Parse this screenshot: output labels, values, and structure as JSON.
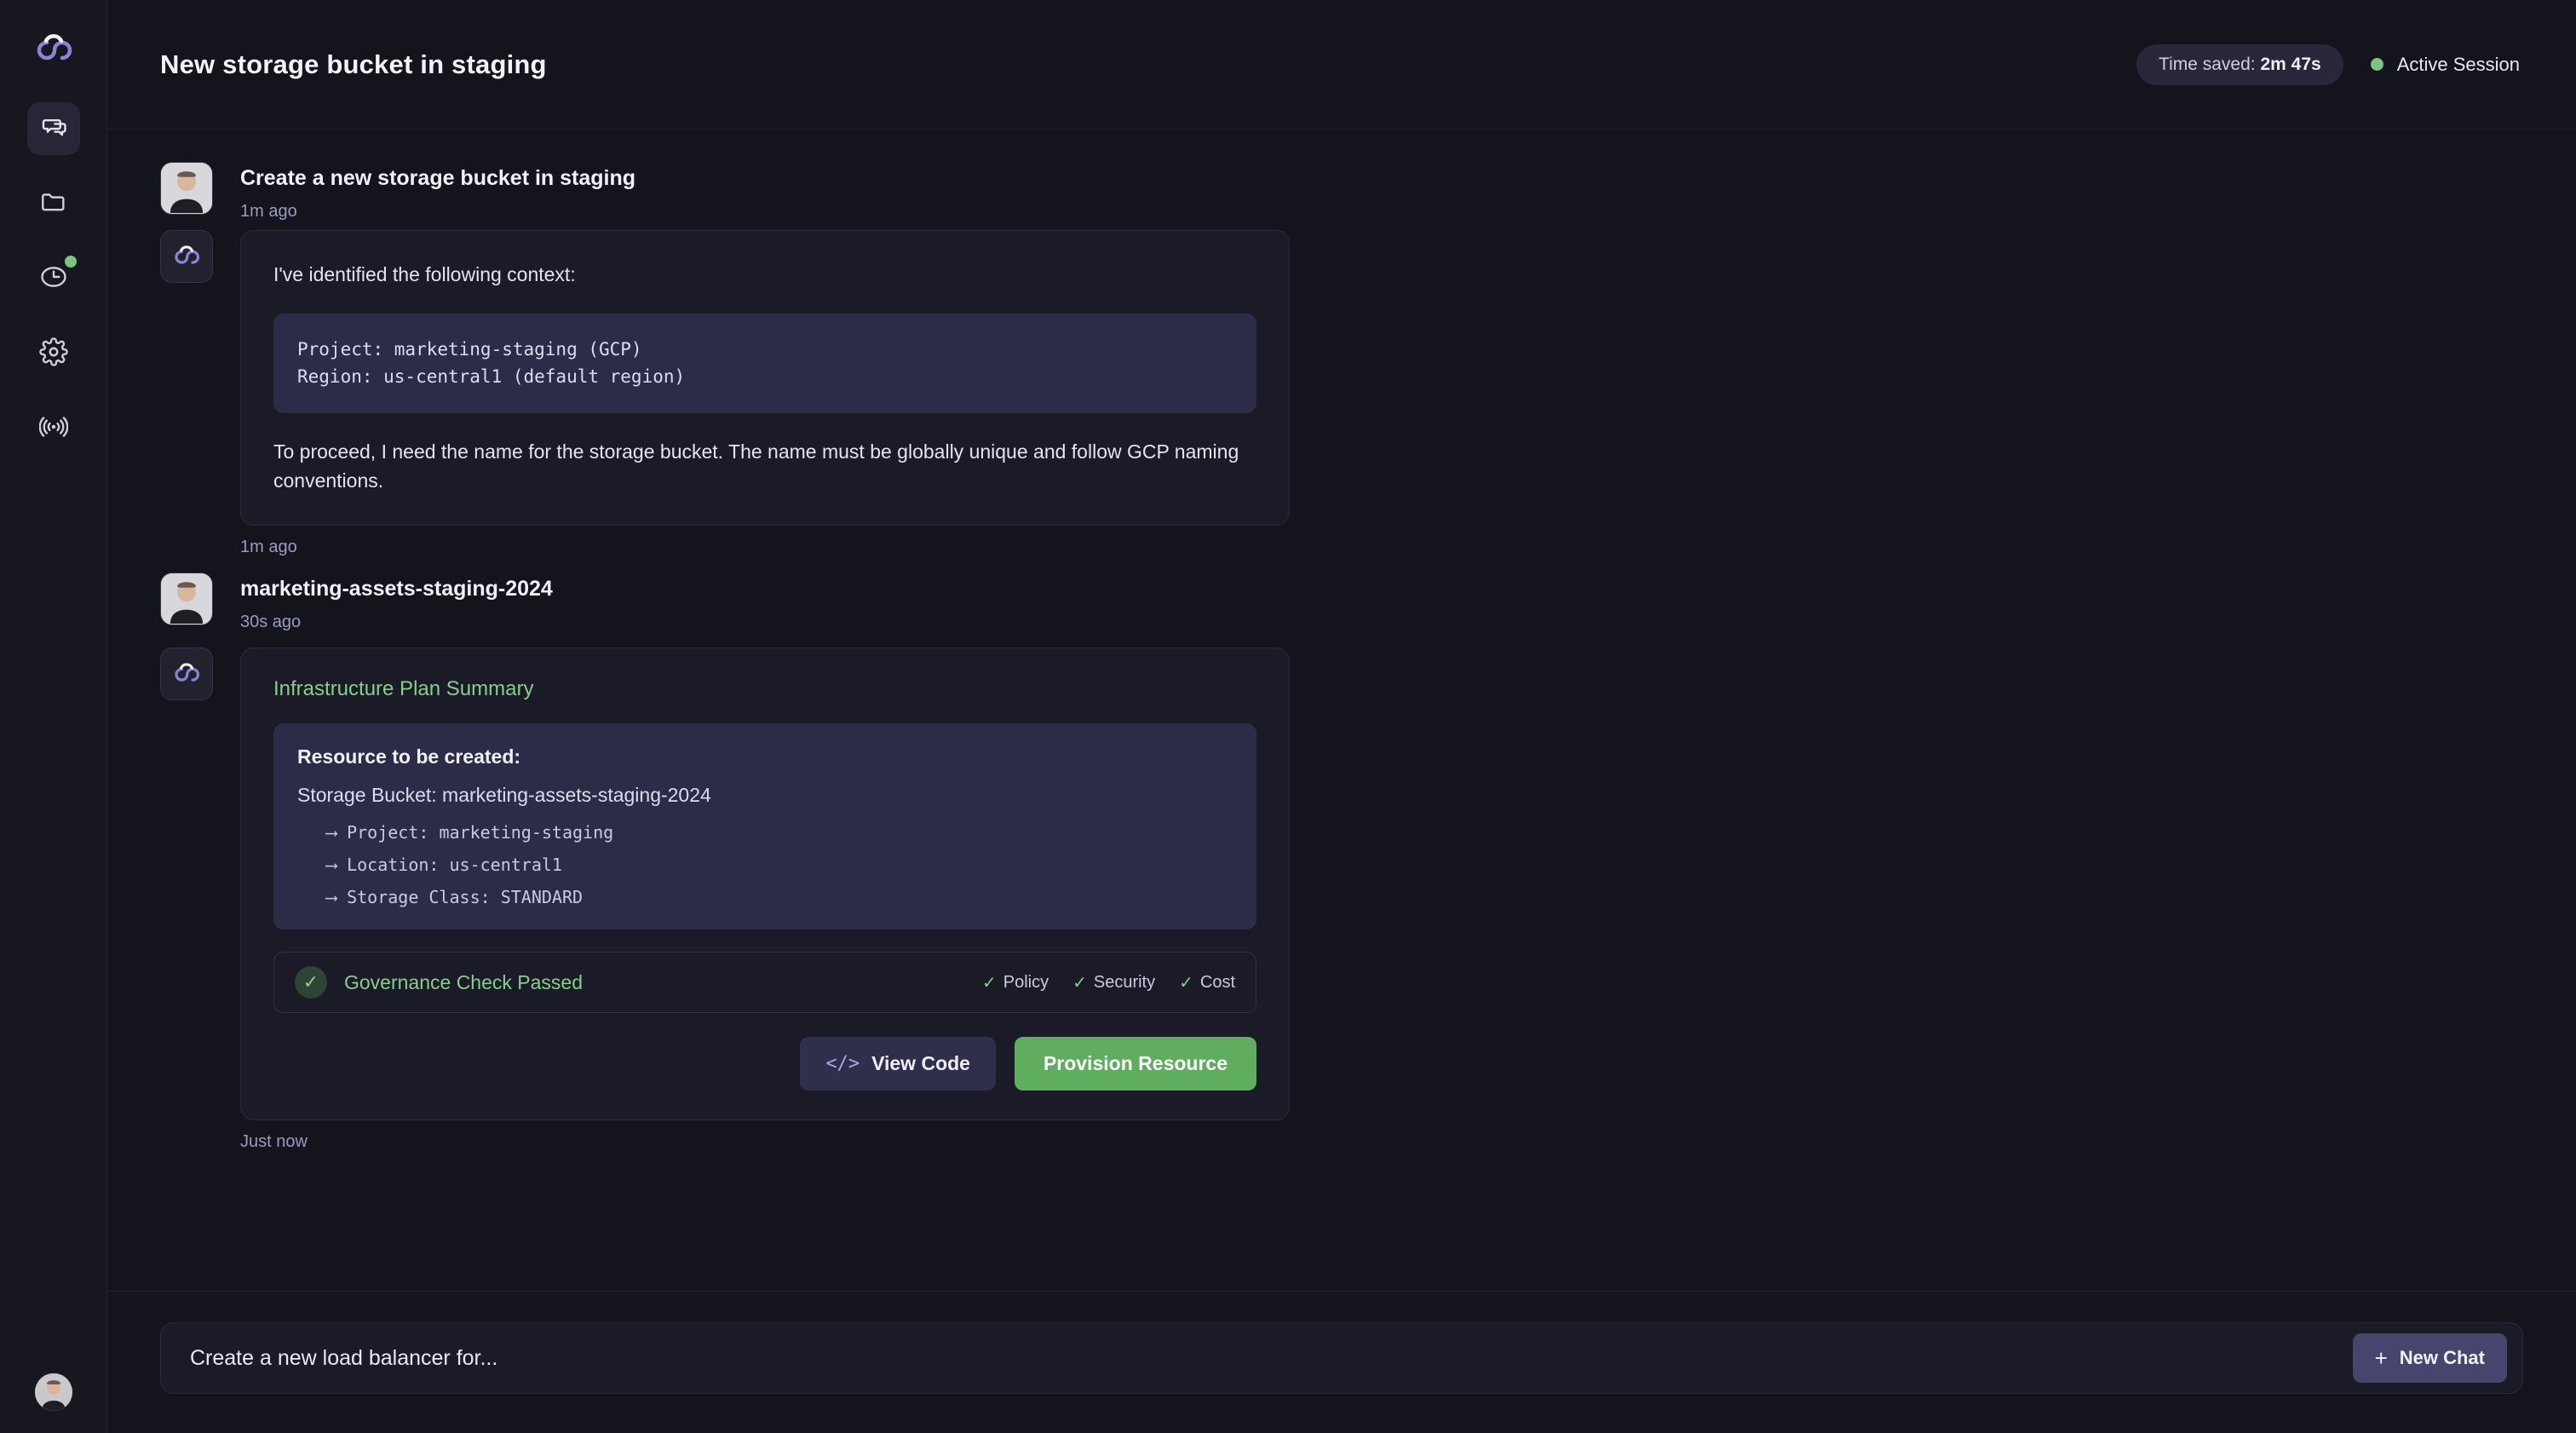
{
  "sidebar": {
    "logo_icon": "cloud-logo-icon",
    "items": [
      {
        "id": "chats",
        "icon": "chat-bubbles-icon",
        "active": true,
        "badge": false
      },
      {
        "id": "files",
        "icon": "folder-icon",
        "active": false,
        "badge": false
      },
      {
        "id": "history",
        "icon": "clock-icon",
        "active": false,
        "badge": true
      },
      {
        "id": "settings",
        "icon": "gear-icon",
        "active": false,
        "badge": false
      },
      {
        "id": "activity",
        "icon": "broadcast-icon",
        "active": false,
        "badge": false
      }
    ],
    "user_avatar_icon": "user-avatar-photo"
  },
  "header": {
    "title": "New storage bucket in staging",
    "time_saved_prefix": "Time saved: ",
    "time_saved_value": "2m 47s",
    "session_status": "Active Session",
    "session_color": "#7bc47f"
  },
  "conversation": [
    {
      "role": "user",
      "text": "Create a new storage bucket in staging",
      "timestamp": "1m ago"
    },
    {
      "role": "assistant",
      "intro": "I've identified the following context:",
      "code": "Project: marketing-staging (GCP)\nRegion: us-central1 (default region)",
      "outro": "To proceed, I need the name for the storage bucket. The name must be globally unique and follow GCP naming conventions.",
      "timestamp": "1m ago"
    },
    {
      "role": "user",
      "text": "marketing-assets-staging-2024",
      "timestamp": "30s ago"
    },
    {
      "role": "assistant_plan",
      "plan_title": "Infrastructure Plan Summary",
      "plan_heading": "Resource to be created:",
      "plan_resource": "Storage Bucket: marketing-assets-staging-2024",
      "plan_details": [
        "⟶  Project: marketing-staging",
        "⟶  Location: us-central1",
        "⟶  Storage Class: STANDARD"
      ],
      "governance": {
        "label": "Governance Check Passed",
        "check_icon": "check-icon",
        "checks": [
          "Policy",
          "Security",
          "Cost"
        ],
        "color": "#86cf8a"
      },
      "actions": {
        "view_code": "View Code",
        "view_code_icon": "code-brackets-icon",
        "provision": "Provision Resource",
        "provision_color": "#5fae5f"
      },
      "timestamp": "Just now"
    }
  ],
  "composer": {
    "placeholder": "Create a new load balancer for...",
    "value": "",
    "new_chat_label": "New Chat",
    "new_chat_icon": "plus-icon"
  }
}
